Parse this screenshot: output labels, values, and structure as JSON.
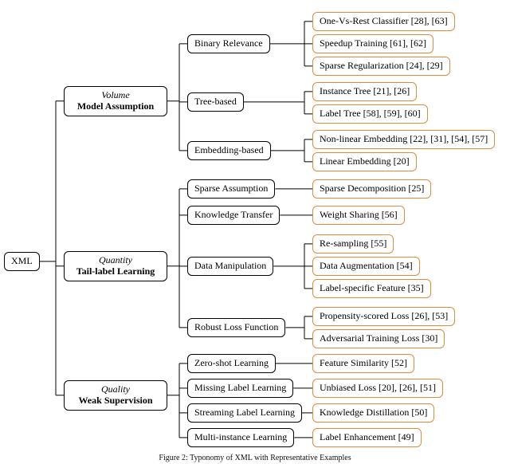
{
  "caption": "Figure 2: Typonomy of XML with Representative Examples",
  "root": {
    "label": "XML"
  },
  "categories": [
    {
      "ital": "Volume",
      "bold": "Model Assumption"
    },
    {
      "ital": "Quantity",
      "bold": "Tail-label Learning"
    },
    {
      "ital": "Quality",
      "bold": "Weak Supervision"
    }
  ],
  "subs_c1": [
    {
      "label": "Binary Relevance"
    },
    {
      "label": "Tree-based"
    },
    {
      "label": "Embedding-based"
    }
  ],
  "subs_c2": [
    {
      "label": "Sparse Assumption"
    },
    {
      "label": "Knowledge Transfer"
    },
    {
      "label": "Data Manipulation"
    },
    {
      "label": "Robust Loss Function"
    }
  ],
  "subs_c3": [
    {
      "label": "Zero-shot Learning"
    },
    {
      "label": "Missing Label Learning"
    },
    {
      "label": "Streaming Label Learning"
    },
    {
      "label": "Multi-instance Learning"
    }
  ],
  "leaves_br": [
    {
      "label": "One-Vs-Rest Classifier [28], [63]"
    },
    {
      "label": "Speedup Training [61], [62]"
    },
    {
      "label": "Sparse Regularization [24], [29]"
    }
  ],
  "leaves_tb": [
    {
      "label": "Instance Tree [21], [26]"
    },
    {
      "label": "Label Tree [58], [59], [60]"
    }
  ],
  "leaves_eb": [
    {
      "label": "Non-linear Embedding [22], [31], [54], [57]"
    },
    {
      "label": "Linear Embedding [20]"
    }
  ],
  "leaves_sa": [
    {
      "label": "Sparse Decomposition [25]"
    }
  ],
  "leaves_kt": [
    {
      "label": "Weight Sharing [56]"
    }
  ],
  "leaves_dm": [
    {
      "label": "Re-sampling [55]"
    },
    {
      "label": "Data Augmentation [54]"
    },
    {
      "label": "Label-specific Feature [35]"
    }
  ],
  "leaves_rl": [
    {
      "label": "Propensity-scored Loss [26], [53]"
    },
    {
      "label": "Adversarial Training Loss [30]"
    }
  ],
  "leaves_zs": [
    {
      "label": "Feature Similarity [52]"
    }
  ],
  "leaves_ml": [
    {
      "label": "Unbiased Loss [20], [26], [51]"
    }
  ],
  "leaves_sl": [
    {
      "label": "Knowledge Distillation [50]"
    }
  ],
  "leaves_mi": [
    {
      "label": "Label Enhancement [49]"
    }
  ]
}
